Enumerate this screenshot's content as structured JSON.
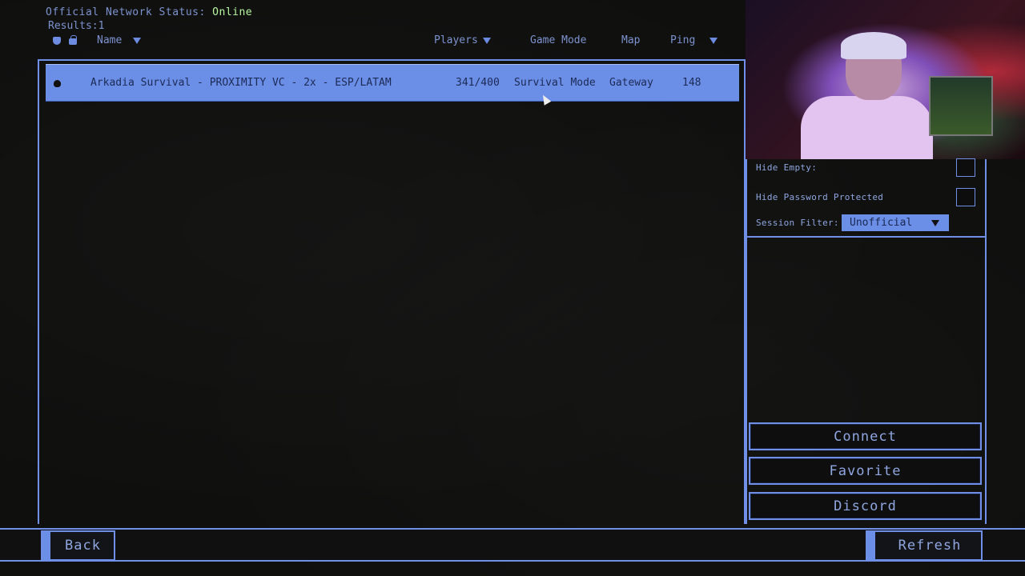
{
  "header": {
    "status_label": "Official Network Status:",
    "status_value": "Online",
    "results_label": "Results:",
    "results_count": "1"
  },
  "columns": {
    "name": "Name",
    "players": "Players",
    "game_mode": "Game Mode",
    "map": "Map",
    "ping": "Ping"
  },
  "servers": [
    {
      "name": "Arkadia Survival - PROXIMITY VC - 2x - ESP/LATAM",
      "players": "341/400",
      "game_mode": "Survival Mode",
      "map": "Gateway",
      "ping": "148",
      "selected": true
    }
  ],
  "filters": {
    "hide_empty_label": "Hide Empty:",
    "hide_empty_checked": false,
    "hide_password_label": "Hide Password Protected",
    "hide_password_checked": false,
    "session_filter_label": "Session Filter:",
    "session_filter_value": "Unofficial"
  },
  "actions": {
    "connect": "Connect",
    "favorite": "Favorite",
    "discord": "Discord"
  },
  "footer": {
    "back": "Back",
    "refresh": "Refresh"
  },
  "colors": {
    "accent": "#6f8fe8",
    "selected_row": "#6b8ee6",
    "online": "#b7f7a0"
  },
  "icons": [
    "shield-icon",
    "lock-icon",
    "sort-arrow-icon",
    "dropdown-arrow-icon"
  ]
}
